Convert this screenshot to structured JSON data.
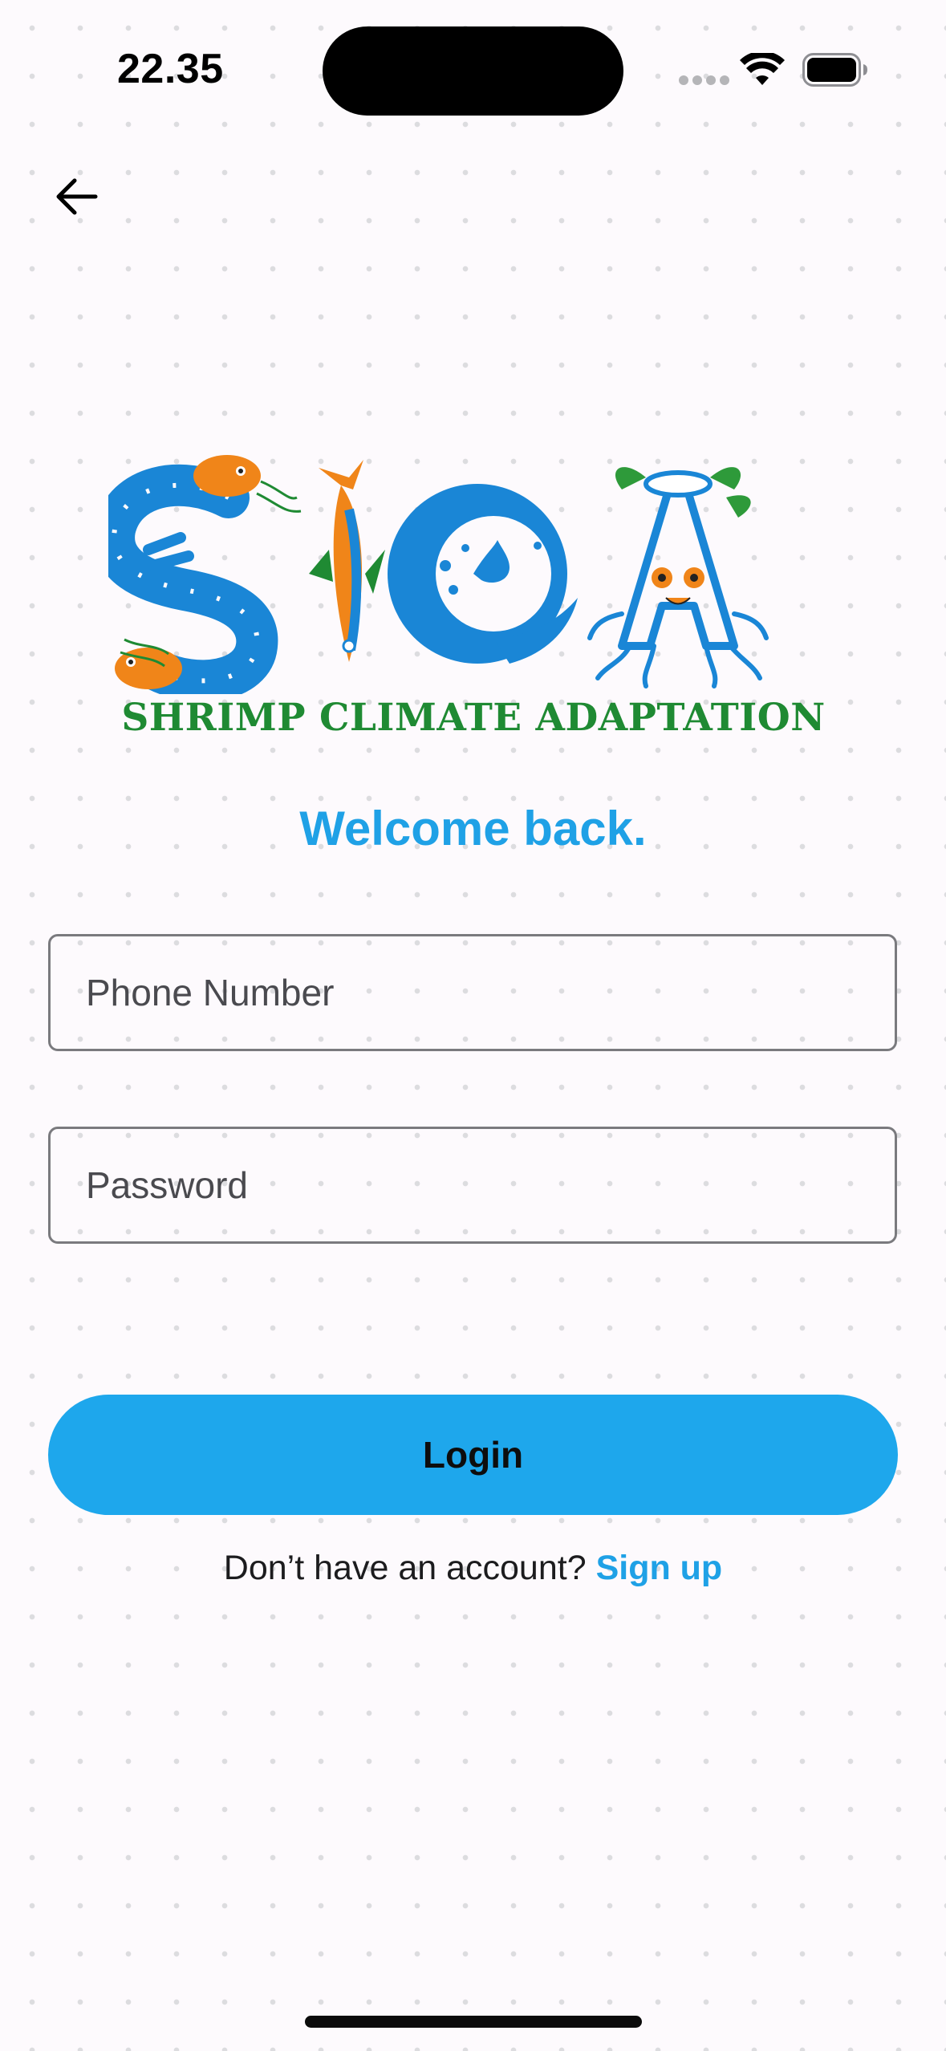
{
  "status_bar": {
    "time": "22.35"
  },
  "nav": {
    "back_icon": "arrow-left-icon"
  },
  "logo": {
    "letters": "SICA",
    "caption": "SHRIMP CLIMATE ADAPTATION",
    "colors": {
      "blue": "#1a86d6",
      "orange": "#f08519",
      "green": "#1f8a33"
    }
  },
  "welcome": {
    "title": "Welcome back."
  },
  "form": {
    "phone_placeholder": "Phone Number",
    "password_placeholder": "Password",
    "login_label": "Login"
  },
  "footer": {
    "prompt": "Don’t have an account?",
    "signup_label": "Sign up"
  },
  "colors": {
    "accent": "#1fa1e6",
    "button": "#1ea7ec",
    "background": "#fdfafd"
  }
}
